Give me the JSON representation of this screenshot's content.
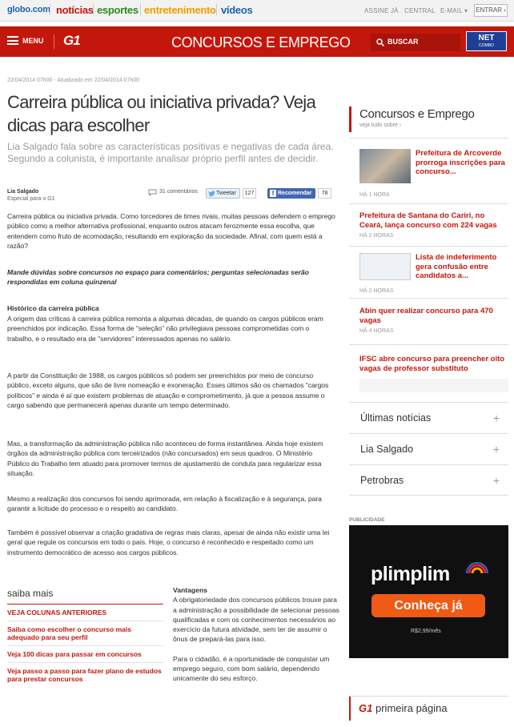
{
  "topbar": {
    "brand": "globo.com",
    "nav": [
      {
        "label": "notícias",
        "color": "#c4170c"
      },
      {
        "label": "esportes",
        "color": "#2d8c1a"
      },
      {
        "label": "entretenimento",
        "color": "#f29d00"
      },
      {
        "label": "vídeos",
        "color": "#1a63a8"
      }
    ],
    "links": [
      "ASSINE JÁ",
      "CENTRAL",
      "E-MAIL ▾"
    ],
    "login": "ENTRAR ›"
  },
  "header": {
    "menu": "MENU",
    "logo": "G1",
    "section": "CONCURSOS E EMPREGO",
    "search": "BUSCAR",
    "partner": {
      "line1": "NET",
      "line2": "COMBO"
    },
    "accent": "#c4170c"
  },
  "article": {
    "date": "22/04/2014 07h00 - Atualizado em 22/04/2014 07h00",
    "title": "Carreira pública ou iniciativa privada? Veja dicas para escolher",
    "subtitle": "Lia Salgado fala sobre as características positivas e negativas de cada área. Segundo a colunista, é importante analisar próprio perfil antes de decidir.",
    "author": "Lia Salgado",
    "author_role": "Especial para o G1",
    "comments": "31 comentários",
    "tweet": "Tweetar",
    "tweet_count": "127",
    "fb": "Recomendar",
    "fb_count": "78",
    "p1": "Carreira pública ou iniciativa privada. Como torcedores de times rivais, muitas pessoas defendem o emprego público como a melhor alternativa profissional, enquanto outros atacam ferozmente essa escolha, que entendem como fruto de acomodação, resultando em exploração da sociedade. Afinal, com quem está a razão?",
    "p2": "Mande dúvidas sobre concursos no espaço para comentários; perguntas selecionadas serão respondidas em coluna quinzenal",
    "h1": "Histórico da carreira pública",
    "p3": "A origem das críticas à carreira pública remonta a algumas décadas, de quando os cargos públicos eram preenchidos por indicação. Essa forma de \"seleção\" não privilegiava pessoas comprometidas com o trabalho, e o resultado era de \"servidores\" interessados apenas no salário.",
    "p4": "A partir da Constituição de 1988, os cargos públicos só podem ser preenchidos por meio de concurso público, exceto alguns, que são de livre nomeação e exoneração. Esses últimos são os chamados \"cargos políticos\" e ainda é aí que existem problemas de atuação e comprometimento, já que a pessoa assume o cargo sabendo que permanecerá apenas durante um tempo determinado.",
    "p5": "Mas, a transformação da administração pública não aconteceu de forma instantânea. Ainda hoje existem órgãos da administração pública com terceirizados (não concursados) em seus quadros. O Ministério Público do Trabalho tem atuado para promover termos de ajustamento de conduta para regularizar essa situação.",
    "p6": "Mesmo a realização dos concursos foi sendo aprimorada, em relação à fiscalização e à segurança, para garantir a licitude do processo e o respeito ao candidato.",
    "p7": "Também é possível observar a criação gradativa de regras mais claras, apesar de ainda não existir uma lei geral que regule os concursos em todo o país. Hoje, o concurso é reconhecido e respeitado como um instrumento democrático de acesso aos cargos públicos.",
    "h2": "Vantagens",
    "p8": "A obrigatoriedade dos concursos públicos trouxe para a administração a possibilidade de selecionar pessoas qualificadas e com os conhecimentos necessários ao exercício da futura atividade, sem ter de assumir o ônus de prepará-las para isso.",
    "p9": "Para o cidadão, é a oportunidade de conquistar um emprego seguro, com bom salário, dependendo unicamente do seu esforço."
  },
  "saiba": {
    "head": "saiba mais",
    "items": [
      "VEJA COLUNAS ANTERIORES",
      "Saiba como escolher o concurso mais adequado para seu perfil",
      "Veja 100 dicas para passar em concursos",
      "Veja passo a passo para fazer plano de estudos para prestar concursos"
    ]
  },
  "sidebar": {
    "title": "Concursos e Emprego",
    "sub": "veja tudo sobre ›",
    "news": [
      {
        "title": "Prefeitura de Arcoverde prorroga inscrições para concurso...",
        "time": "HÁ 1 HORA"
      },
      {
        "title": "Prefeitura de Santana do Cariri, no Ceará, lança concurso com 224 vagas",
        "time": "HÁ 2 HORAS"
      },
      {
        "title": "Lista de indeferimento gera confusão entre candidatos a...",
        "time": "HÁ 2 HORAS"
      },
      {
        "title": "Abin quer realizar concurso para 470 vagas",
        "time": "HÁ 4 HORAS"
      },
      {
        "title": "IFSC abre concurso para preencher oito vagas de professor substituto",
        "time": ""
      }
    ],
    "accordion": [
      "Últimas notícias",
      "Lia Salgado",
      "Petrobras"
    ],
    "publicidade": "PUBLICIDADE",
    "ad": {
      "logo": "plimplim",
      "cta": "Conheça já",
      "price": "R$2,99/mês"
    },
    "primeira": {
      "logo": "G1",
      "label": "primeira página"
    }
  }
}
